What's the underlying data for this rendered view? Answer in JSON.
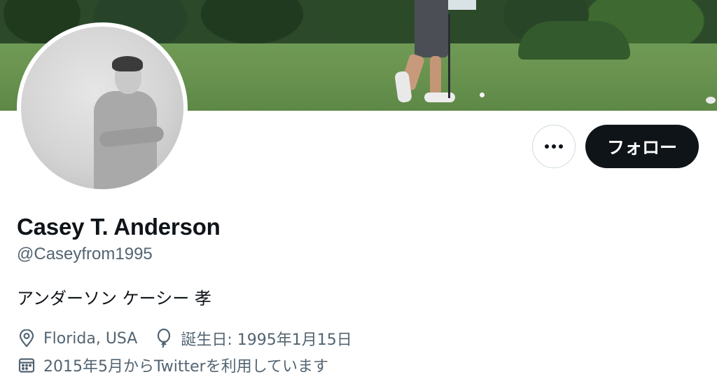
{
  "profile": {
    "name": "Casey T. Anderson",
    "handle": "@Caseyfrom1995",
    "bio": "アンダーソン ケーシー 孝",
    "location": "Florida, USA",
    "birthday": "誕生日: 1995年1月15日",
    "joined": "2015年5月からTwitterを利用しています"
  },
  "actions": {
    "more_icon": "more-horizontal-icon",
    "follow_label": "フォロー"
  },
  "icons": {
    "location": "location-pin-icon",
    "birthday": "balloon-icon",
    "joined": "calendar-icon"
  },
  "colors": {
    "text_primary": "#0f1419",
    "text_secondary": "#536471",
    "button_dark": "#0f1419",
    "border": "#cfd9de"
  }
}
